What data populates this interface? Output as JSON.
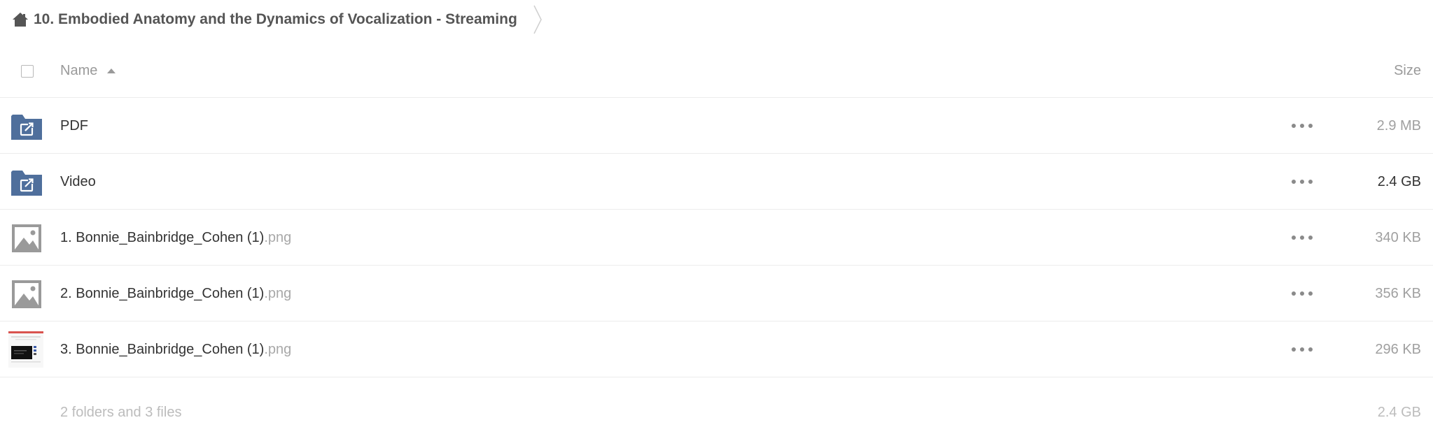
{
  "breadcrumb": {
    "home_icon": "home-icon",
    "title": "10. Embodied Anatomy and the Dynamics of Vocalization - Streaming"
  },
  "table": {
    "header": {
      "name_label": "Name",
      "size_label": "Size",
      "sort_direction": "ascending"
    },
    "rows": [
      {
        "type": "shared-folder",
        "icon": "shared-folder-icon",
        "name": "PDF",
        "ext": "",
        "size": "2.9 MB"
      },
      {
        "type": "shared-folder",
        "icon": "shared-folder-icon",
        "name": "Video",
        "ext": "",
        "size": "2.4 GB"
      },
      {
        "type": "image",
        "icon": "image-icon",
        "name": "1. Bonnie_Bainbridge_Cohen (1)",
        "ext": ".png",
        "size": "340 KB"
      },
      {
        "type": "image",
        "icon": "image-icon",
        "name": "2. Bonnie_Bainbridge_Cohen (1)",
        "ext": ".png",
        "size": "356 KB"
      },
      {
        "type": "image-thumbnail",
        "icon": "thumbnail-icon",
        "name": "3. Bonnie_Bainbridge_Cohen (1)",
        "ext": ".png",
        "size": "296 KB"
      }
    ]
  },
  "summary": {
    "text": "2 folders and 3 files",
    "total_size": "2.4 GB"
  },
  "colors": {
    "folder_blue": "#4f6f9c",
    "image_gray": "#9a9a9a",
    "divider": "#ececec",
    "muted_text": "#a0a0a0"
  }
}
